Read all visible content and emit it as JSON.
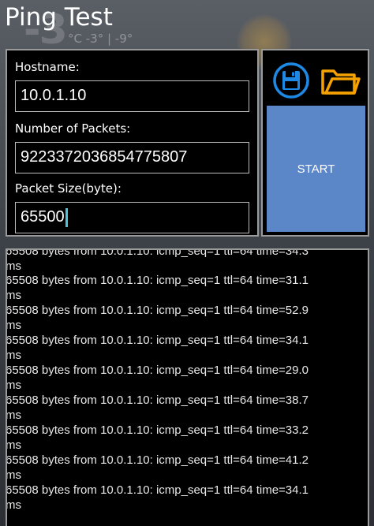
{
  "wallpaper": {
    "temp": "-3",
    "sub": "°C  -3° | -9°"
  },
  "app": {
    "title": "Ping Test"
  },
  "form": {
    "hostname_label": "Hostname:",
    "hostname_value": "10.0.1.10",
    "packets_label": "Number of Packets:",
    "packets_value": "9223372036854775807",
    "size_label": "Packet Size(byte):",
    "size_value": "65500"
  },
  "actions": {
    "save_icon": "save-disk-icon",
    "open_icon": "folder-open-icon",
    "start_label": "START",
    "colors": {
      "accent_blue": "#1e88e5",
      "accent_orange": "#f5a200",
      "start_bg": "#5b87c8"
    }
  },
  "log": {
    "partial_line": "65508 bytes from 10.0.1.10: icmp_seq=1 ttl=64 time=34.3",
    "partial_unit": "ms",
    "lines": [
      {
        "text": "65508 bytes from 10.0.1.10: icmp_seq=1 ttl=64 time=31.1",
        "unit": "ms"
      },
      {
        "text": "65508 bytes from 10.0.1.10: icmp_seq=1 ttl=64 time=52.9",
        "unit": "ms"
      },
      {
        "text": "65508 bytes from 10.0.1.10: icmp_seq=1 ttl=64 time=34.1",
        "unit": "ms"
      },
      {
        "text": "65508 bytes from 10.0.1.10: icmp_seq=1 ttl=64 time=29.0",
        "unit": "ms"
      },
      {
        "text": "65508 bytes from 10.0.1.10: icmp_seq=1 ttl=64 time=38.7",
        "unit": "ms"
      },
      {
        "text": "65508 bytes from 10.0.1.10: icmp_seq=1 ttl=64 time=33.2",
        "unit": "ms"
      },
      {
        "text": "65508 bytes from 10.0.1.10: icmp_seq=1 ttl=64 time=41.2",
        "unit": "ms"
      },
      {
        "text": "65508 bytes from 10.0.1.10: icmp_seq=1 ttl=64 time=34.1",
        "unit": "ms"
      }
    ]
  }
}
